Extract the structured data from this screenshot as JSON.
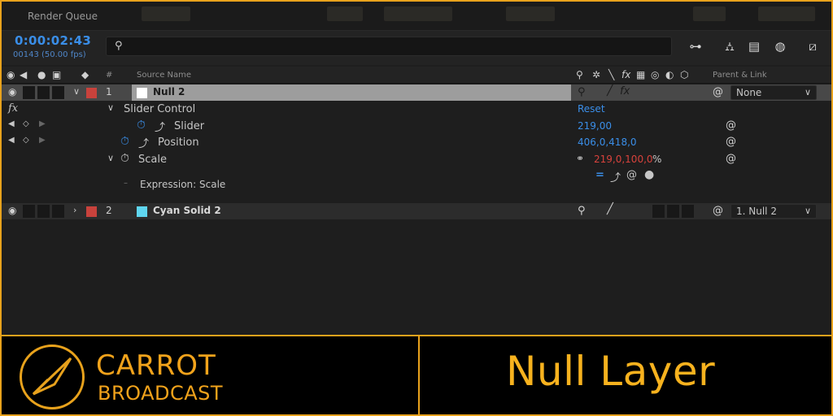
{
  "tabbar": {
    "render_queue": "Render Queue"
  },
  "timebar": {
    "timecode": "0:00:02:43",
    "frames": "00143 (50.00 fps)",
    "search_placeholder": ""
  },
  "header": {
    "hash": "#",
    "source_name": "Source Name",
    "parent_link": "Parent & Link"
  },
  "layers": [
    {
      "index": "1",
      "name": "Null 2",
      "label_color": "#c8423c",
      "swatch_color": "#ffffff",
      "parent": "None"
    },
    {
      "index": "2",
      "name": "Cyan Solid 2",
      "label_color": "#c8423c",
      "swatch_color": "#5fd6f0",
      "parent": "1. Null 2"
    }
  ],
  "props": {
    "fx": "fx",
    "slider_control": "Slider Control",
    "reset": "Reset",
    "slider": "Slider",
    "slider_value": "219,00",
    "position": "Position",
    "position_value": "406,0,418,0",
    "scale": "Scale",
    "scale_value": "219,0,100,0",
    "scale_unit": "%",
    "expression": "Expression: Scale"
  },
  "footer": {
    "brand_line1": "CARROT",
    "brand_line2": "BROADCAST",
    "title": "Null Layer"
  },
  "colors": {
    "accent": "#e8a21c",
    "timecode": "#3a8ee8",
    "expr_red": "#d8423c"
  }
}
